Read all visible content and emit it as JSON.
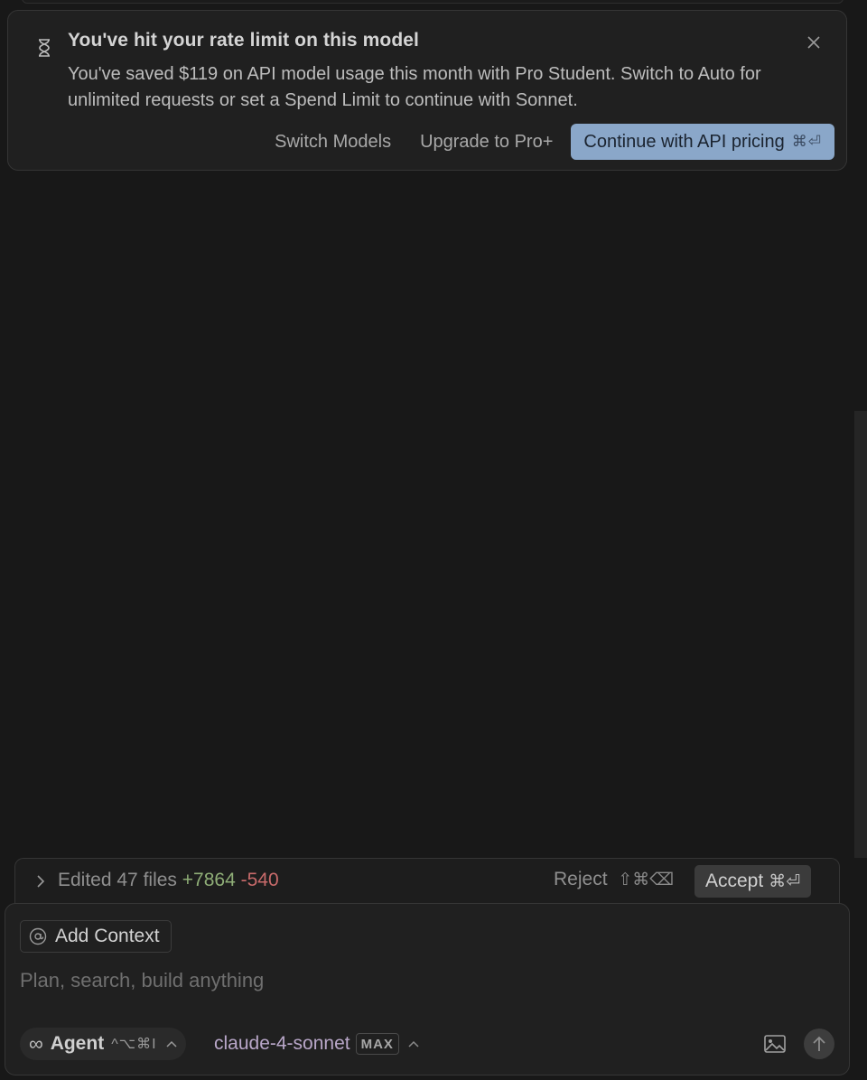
{
  "notice": {
    "title": "You've hit your rate limit on this model",
    "body": "You've saved $119 on API model usage this month with Pro Student. Switch to Auto for unlimited requests or set a Spend Limit to continue with Sonnet.",
    "actions": {
      "switch_models": "Switch Models",
      "upgrade": "Upgrade to Pro+",
      "continue": "Continue with API pricing",
      "continue_shortcut": "⌘⏎"
    },
    "accent_color": "#8aa7c9"
  },
  "edits": {
    "label": "Edited 47 files",
    "added": "+7864",
    "removed": "-540",
    "reject_label": "Reject",
    "reject_shortcut": "⇧⌘⌫",
    "accept_label": "Accept",
    "accept_shortcut": "⌘⏎",
    "added_color": "#8fae77",
    "removed_color": "#c76a6a"
  },
  "composer": {
    "context_label": "Add Context",
    "placeholder": "Plan, search, build anything",
    "mode_label": "Agent",
    "mode_shortcut": "^⌥⌘I",
    "model_name": "claude-4-sonnet",
    "model_badge": "MAX"
  },
  "icons": {
    "notice": "hourglass-icon",
    "close": "close-icon",
    "expand": "chevron-right-icon",
    "context": "at-sign-icon",
    "mode": "infinity-icon",
    "image": "image-icon",
    "send": "arrow-up-icon"
  }
}
